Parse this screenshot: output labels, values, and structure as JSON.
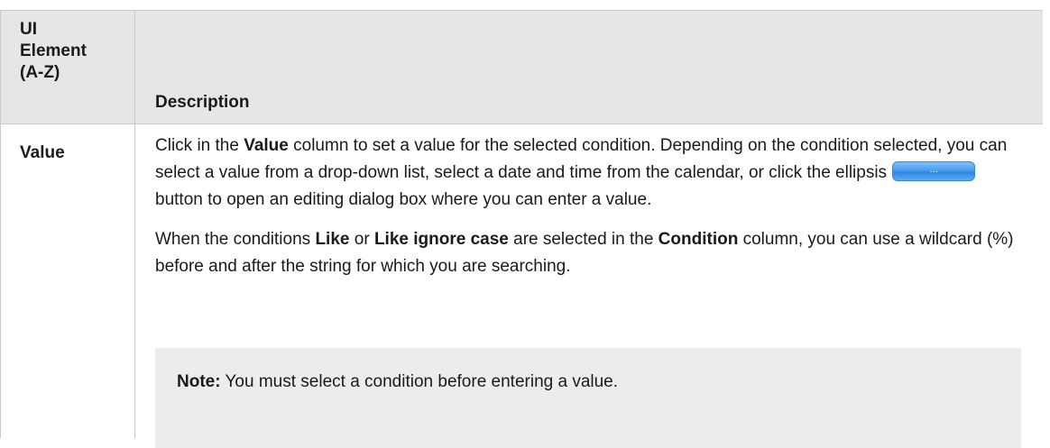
{
  "table": {
    "header": {
      "col1_lines": [
        "UI",
        "Element",
        "(A-Z)"
      ],
      "col2": "Description"
    },
    "row": {
      "name": "Value",
      "p1": {
        "t1": "Click in the ",
        "b1": "Value",
        "t2": " column to set a value for the selected condition. Depending on the condition selected, you can select a value from a drop-down list, select a date and time from the calendar, or click the ellipsis",
        "button_label": "...",
        "t3": "button to open an editing dialog box where you can enter a value."
      },
      "p2": {
        "t1": "When the conditions ",
        "b1": "Like",
        "t2": " or ",
        "b2": "Like ignore case",
        "t3": " are selected in the ",
        "b3": "Condition",
        "t4": " column, you can use a wildcard (%) before and after the string for which you are searching."
      },
      "note": {
        "label": "Note:",
        "text": " You must select a condition before entering a value."
      }
    }
  }
}
